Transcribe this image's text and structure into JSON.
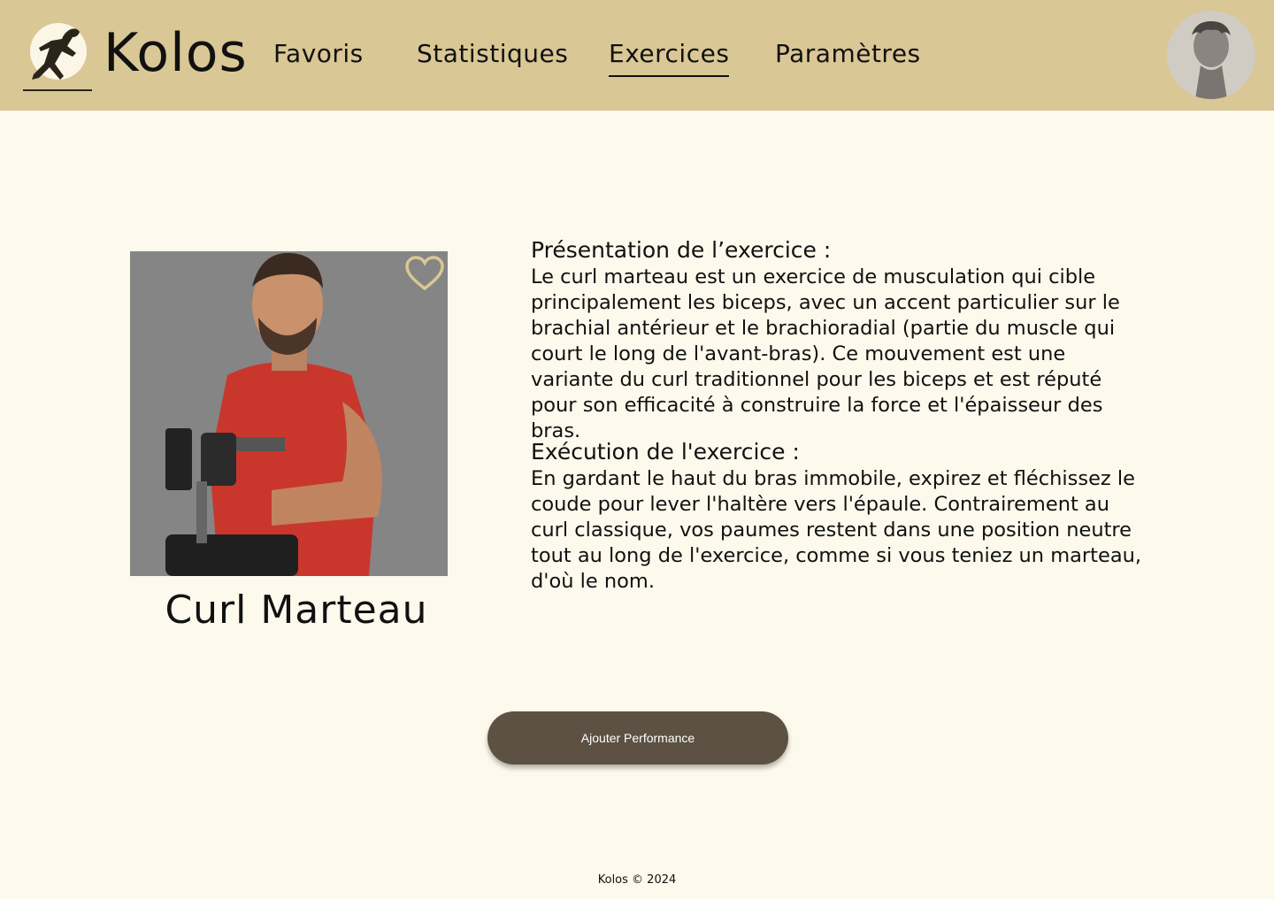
{
  "header": {
    "brand": "Kolos",
    "nav": [
      {
        "label": "Favoris",
        "active": false
      },
      {
        "label": "Statistiques",
        "active": false
      },
      {
        "label": "Exercices",
        "active": true
      },
      {
        "label": "Paramètres",
        "active": false
      }
    ],
    "logo_icon": "running-athlete-icon",
    "avatar_icon": "greek-statue-avatar"
  },
  "exercise": {
    "name": "Curl Marteau",
    "image_icon": "athlete-dumbbell-photo",
    "favorite_icon": "heart-outline-icon",
    "presentation_title": "Présentation de l’exercice :",
    "presentation_text": "Le curl marteau est un exercice de musculation qui cible principalement les biceps, avec un accent particulier sur le brachial antérieur et le brachioradial (partie du muscle qui court le long de l'avant-bras). Ce mouvement est une variante du curl traditionnel pour les biceps et est réputé pour son efficacité à construire la force et l'épaisseur des bras.",
    "execution_title": "Exécution de l'exercice :",
    "execution_text": "En gardant le haut du bras immobile, expirez et fléchissez le coude pour lever l'haltère vers l'épaule. Contrairement au curl classique, vos paumes restent dans une position neutre tout au long de l'exercice, comme si vous teniez un marteau, d'où le nom."
  },
  "actions": {
    "add_performance": "Ajouter Performance"
  },
  "footer": {
    "text": "Kolos © 2024"
  },
  "colors": {
    "header_bg": "#d9c795",
    "page_bg": "#fdf9ec",
    "button_bg": "#5c5142",
    "heart": "#d9c795"
  }
}
